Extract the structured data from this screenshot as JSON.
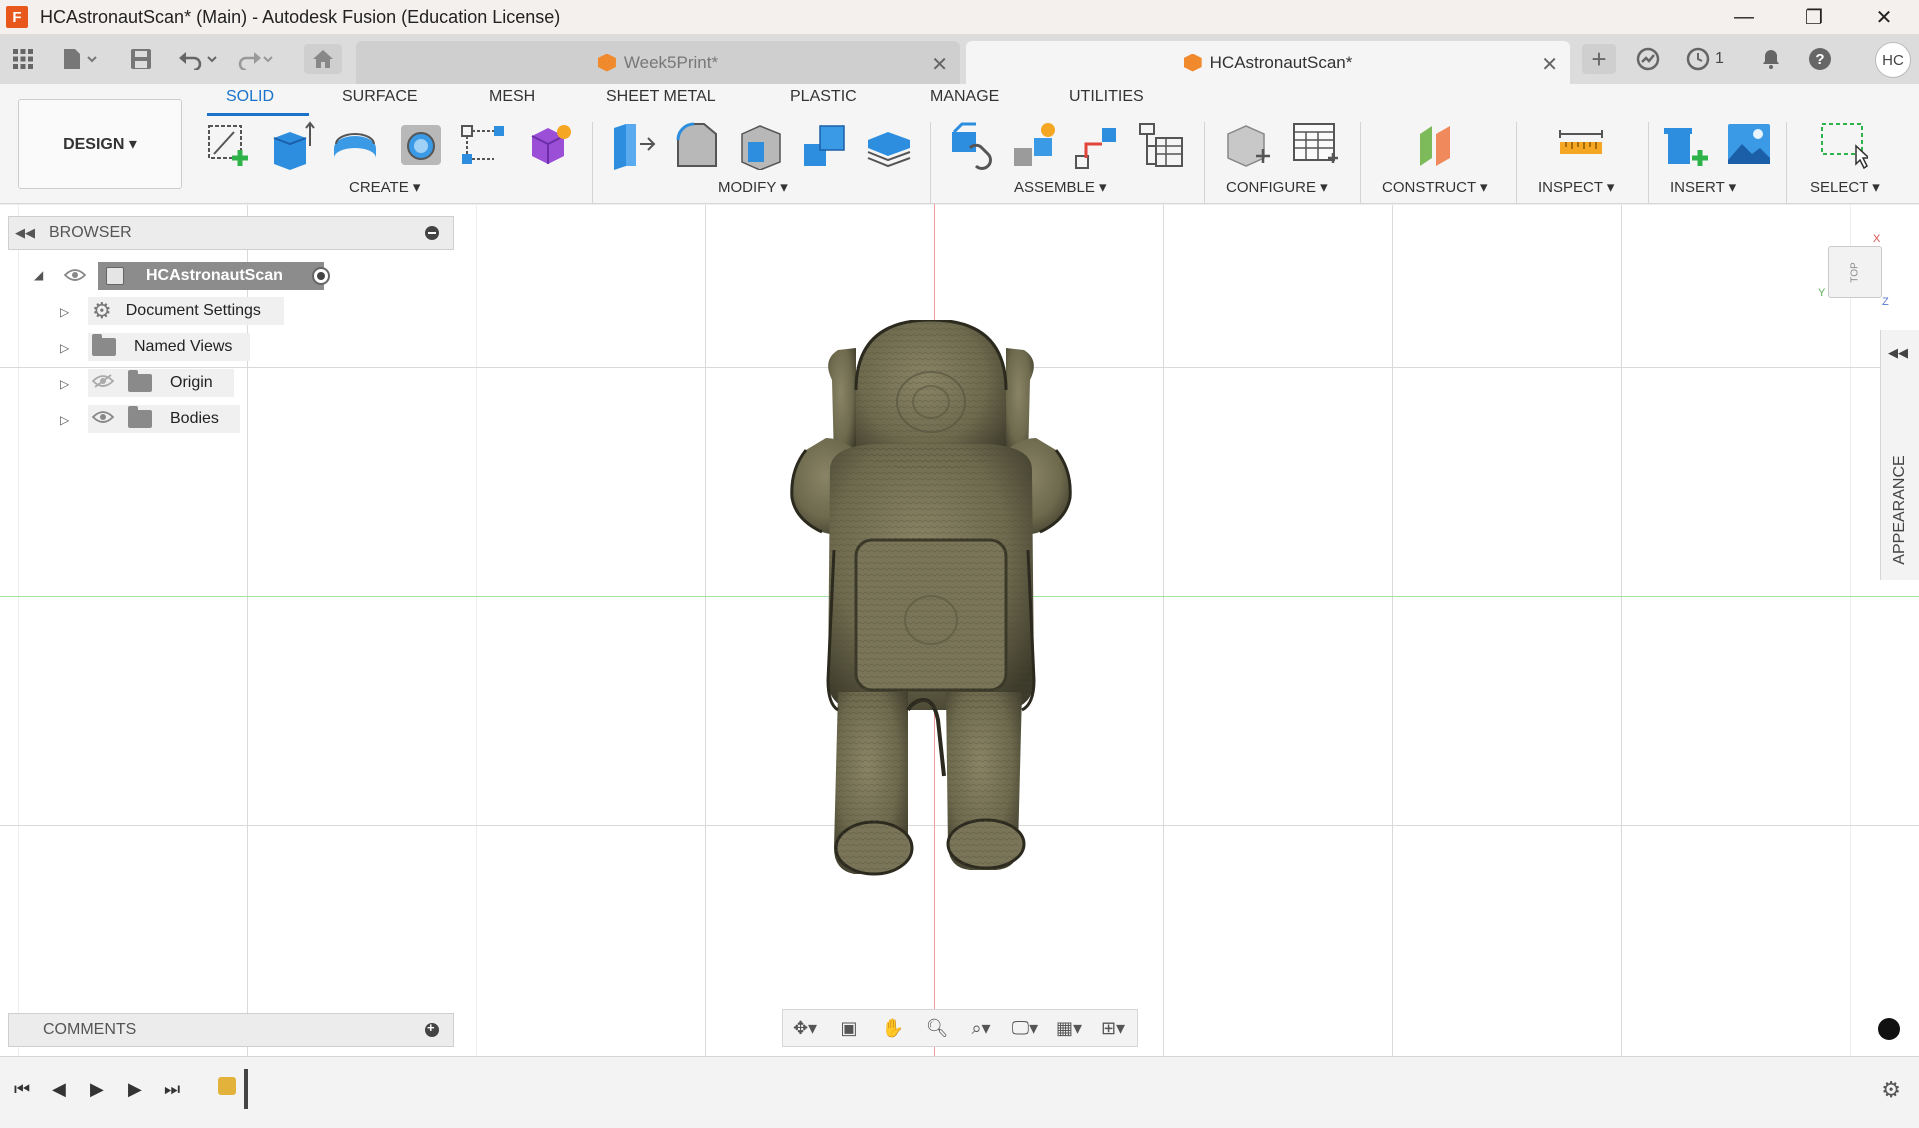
{
  "window": {
    "title": "HCAstronautScan* (Main) - Autodesk Fusion (Education License)",
    "app_icon_letter": "F",
    "minimize": "—",
    "restore": "❐",
    "close": "✕"
  },
  "doc_tabs": [
    {
      "label": "Week5Print*",
      "active": false
    },
    {
      "label": "HCAstronautScan*",
      "active": true
    }
  ],
  "quick_access": {
    "job_count": "1",
    "user_initials": "HC"
  },
  "ribbon": {
    "workspace": "DESIGN ▾",
    "tabs": [
      "SOLID",
      "SURFACE",
      "MESH",
      "SHEET METAL",
      "PLASTIC",
      "MANAGE",
      "UTILITIES"
    ],
    "active_tab": "SOLID",
    "groups": [
      "CREATE ▾",
      "MODIFY ▾",
      "ASSEMBLE ▾",
      "CONFIGURE ▾",
      "CONSTRUCT ▾",
      "INSPECT ▾",
      "INSERT ▾",
      "SELECT ▾"
    ]
  },
  "browser": {
    "title": "BROWSER",
    "root": "HCAstronautScan",
    "items": [
      "Document Settings",
      "Named Views",
      "Origin",
      "Bodies"
    ]
  },
  "comments": {
    "title": "COMMENTS"
  },
  "viewcube": {
    "face": "TOP",
    "x": "X",
    "y": "Y",
    "z": "Z"
  },
  "appearance_panel": {
    "label": "APPEARANCE"
  },
  "colors": {
    "accent": "#1a73c8",
    "model": "#6e6a4e",
    "axis_red": "#f29a9a",
    "axis_green": "#9fe39f"
  }
}
